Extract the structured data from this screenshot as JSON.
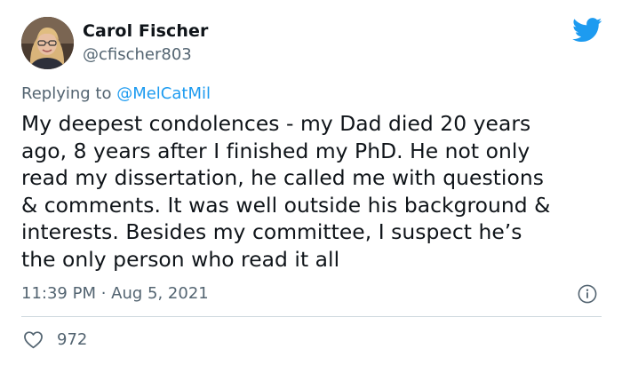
{
  "author": {
    "name": "Carol Fischer",
    "handle": "@cfischer803",
    "avatar_icon": "user-avatar-photo"
  },
  "reply": {
    "prefix": "Replying to ",
    "mention": "@MelCatMil"
  },
  "tweet": {
    "text": "My deepest condolences - my Dad died 20 years\nago, 8 years after I finished my PhD. He not only\nread my dissertation, he called me with questions\n& comments. It was well outside his background &\ninterests. Besides my committee, I suspect he’s\nthe only person who read it all",
    "timestamp": "11:39 PM · Aug 5, 2021"
  },
  "engagement": {
    "likes": "972"
  },
  "colors": {
    "accent": "#1d9bf0",
    "text_primary": "#0f1419",
    "text_secondary": "#536471",
    "divider": "#cfd9de"
  },
  "icons": {
    "brand": "twitter-bird-icon",
    "info": "info-icon",
    "like": "heart-icon"
  }
}
